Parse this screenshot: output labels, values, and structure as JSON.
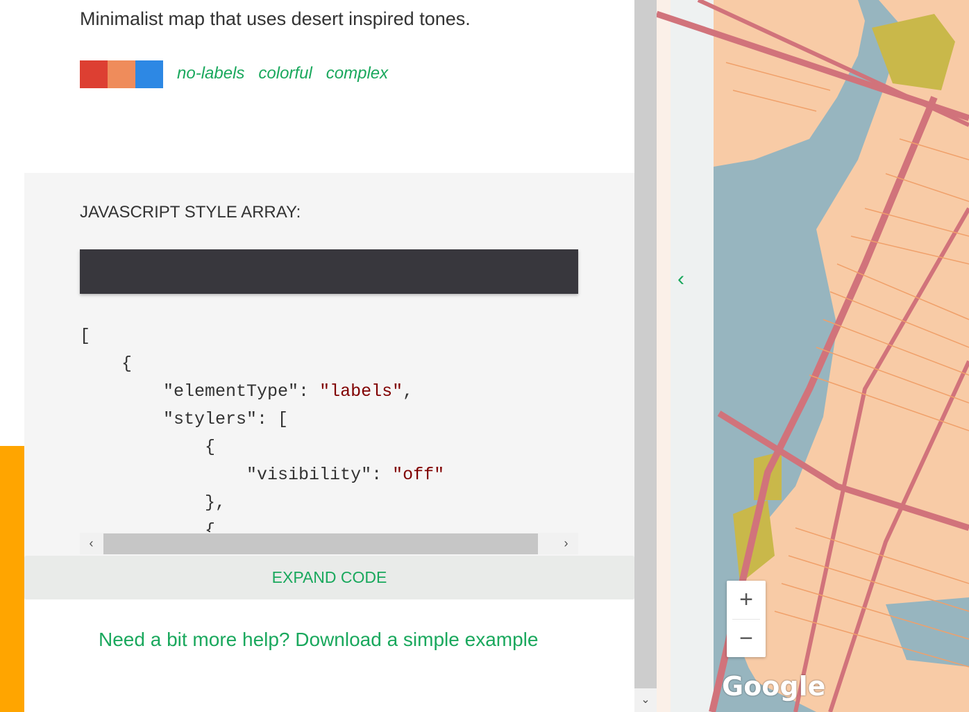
{
  "description": "Minimalist map that uses desert inspired tones.",
  "swatches": [
    "#dd3f32",
    "#ef8c5b",
    "#2d88e4"
  ],
  "tags": [
    "no-labels",
    "colorful",
    "complex"
  ],
  "style_section": {
    "heading": "JAVASCRIPT STYLE ARRAY:",
    "code": {
      "l1": "[",
      "l2": "    {",
      "l3_key": "        \"elementType\": ",
      "l3_val": "\"labels\"",
      "l3_end": ",",
      "l4": "        \"stylers\": [",
      "l5": "            {",
      "l6_key": "                \"visibility\": ",
      "l6_val": "\"off\"",
      "l7": "            },",
      "l8": "            {"
    },
    "expand_label": "EXPAND CODE"
  },
  "scroll_icons": {
    "left": "‹",
    "right": "›",
    "down": "⌄"
  },
  "help_link": "Need a bit more help? Download a simple example",
  "map": {
    "collapse_icon": "‹",
    "zoom_in": "+",
    "zoom_out": "−",
    "logo": "Google",
    "colors": {
      "land": "#f8cba6",
      "water": "#97b5bf",
      "park": "#c9b84a",
      "road": "#d1737b"
    }
  }
}
